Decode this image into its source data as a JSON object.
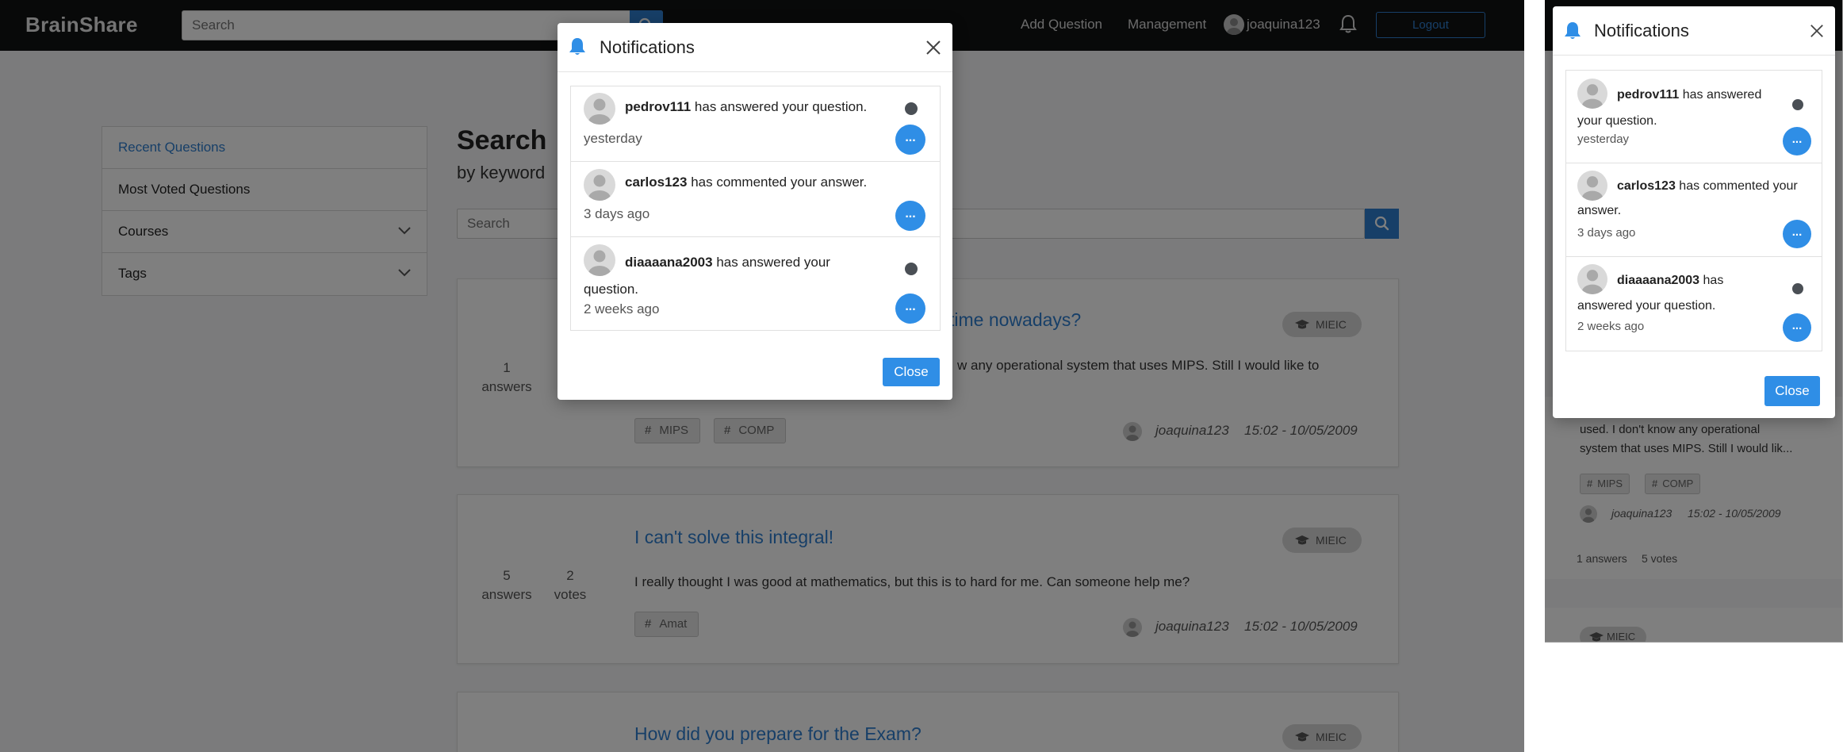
{
  "app": {
    "brand": "BrainShare"
  },
  "nav": {
    "search_placeholder": "Search",
    "add_question": "Add Question",
    "management": "Management",
    "username": "joaquina123",
    "logout": "Logout"
  },
  "sidebar": {
    "items": [
      {
        "label": "Recent Questions"
      },
      {
        "label": "Most Voted Questions"
      },
      {
        "label": "Courses"
      },
      {
        "label": "Tags"
      }
    ]
  },
  "search": {
    "title": "Search",
    "subtitle": "by keyword",
    "placeholder": "Search"
  },
  "questions": [
    {
      "title_visible": "time nowadays?",
      "answers": "1",
      "answers_label": "answers",
      "body_visible": "w any operational system that uses MIPS. Still I would like to",
      "course": "MIEIC",
      "tags": [
        "MIPS",
        "COMP"
      ],
      "author": "joaquina123",
      "date": "15:02 - 10/05/2009"
    },
    {
      "title": "I can't solve this integral!",
      "answers": "5",
      "answers_label": "answers",
      "votes": "2",
      "votes_label": "votes",
      "body": "I really thought I was good at mathematics, but this is to hard for me. Can someone help me?",
      "course": "MIEIC",
      "tags": [
        "Amat"
      ],
      "author": "joaquina123",
      "date": "15:02 - 10/05/2009"
    },
    {
      "title": "How did you prepare for the Exam?",
      "course": "MIEIC"
    }
  ],
  "modal": {
    "title": "Notifications",
    "close_label": "Close",
    "more_label": "...",
    "notifications": [
      {
        "user": "pedrov111",
        "action": "has answered your question.",
        "time": "yesterday",
        "unread": true
      },
      {
        "user": "carlos123",
        "action": "has commented your answer.",
        "time": "3 days ago",
        "unread": false
      },
      {
        "user": "diaaaana2003",
        "action": "has answered your question.",
        "time": "2 weeks ago",
        "unread": true
      }
    ]
  },
  "mobile_bg": {
    "body_lines": [
      "used. I don't know any operational",
      "system that uses MIPS. Still I would lik..."
    ],
    "tags": [
      "MIPS",
      "COMP"
    ],
    "author": "joaquina123",
    "date": "15:02 - 10/05/2009",
    "answers": "1 answers",
    "votes": "5 votes",
    "course": "MIEIC"
  },
  "colors": {
    "accent": "#2f8ee6",
    "link": "#2f7fd1",
    "navbar": "#111213",
    "unread_dot": "#4a4f55"
  }
}
